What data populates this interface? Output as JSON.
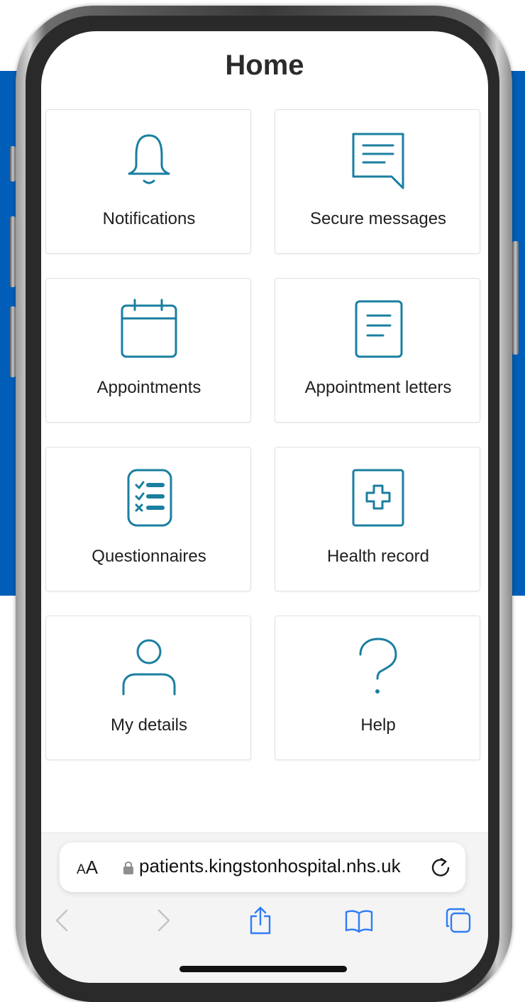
{
  "page": {
    "title": "Home"
  },
  "tiles": [
    {
      "label": "Notifications",
      "icon": "bell-icon"
    },
    {
      "label": "Secure messages",
      "icon": "message-icon"
    },
    {
      "label": "Appointments",
      "icon": "calendar-icon"
    },
    {
      "label": "Appointment letters",
      "icon": "document-icon"
    },
    {
      "label": "Questionnaires",
      "icon": "checklist-icon"
    },
    {
      "label": "Health record",
      "icon": "medical-cross-icon"
    },
    {
      "label": "My details",
      "icon": "person-icon"
    },
    {
      "label": "Help",
      "icon": "question-icon"
    }
  ],
  "browser": {
    "text_size_label_small": "A",
    "text_size_label_large": "A",
    "url": "patients.kingstonhospital.nhs.uk",
    "toolbar": [
      "back-icon",
      "forward-icon",
      "share-icon",
      "bookmarks-icon",
      "tabs-icon"
    ]
  },
  "colors": {
    "accent": "#005eb8",
    "icon_stroke": "#1a7fa0",
    "safari_blue": "#2f7cf6",
    "disabled_gray": "#c4c4c4"
  }
}
